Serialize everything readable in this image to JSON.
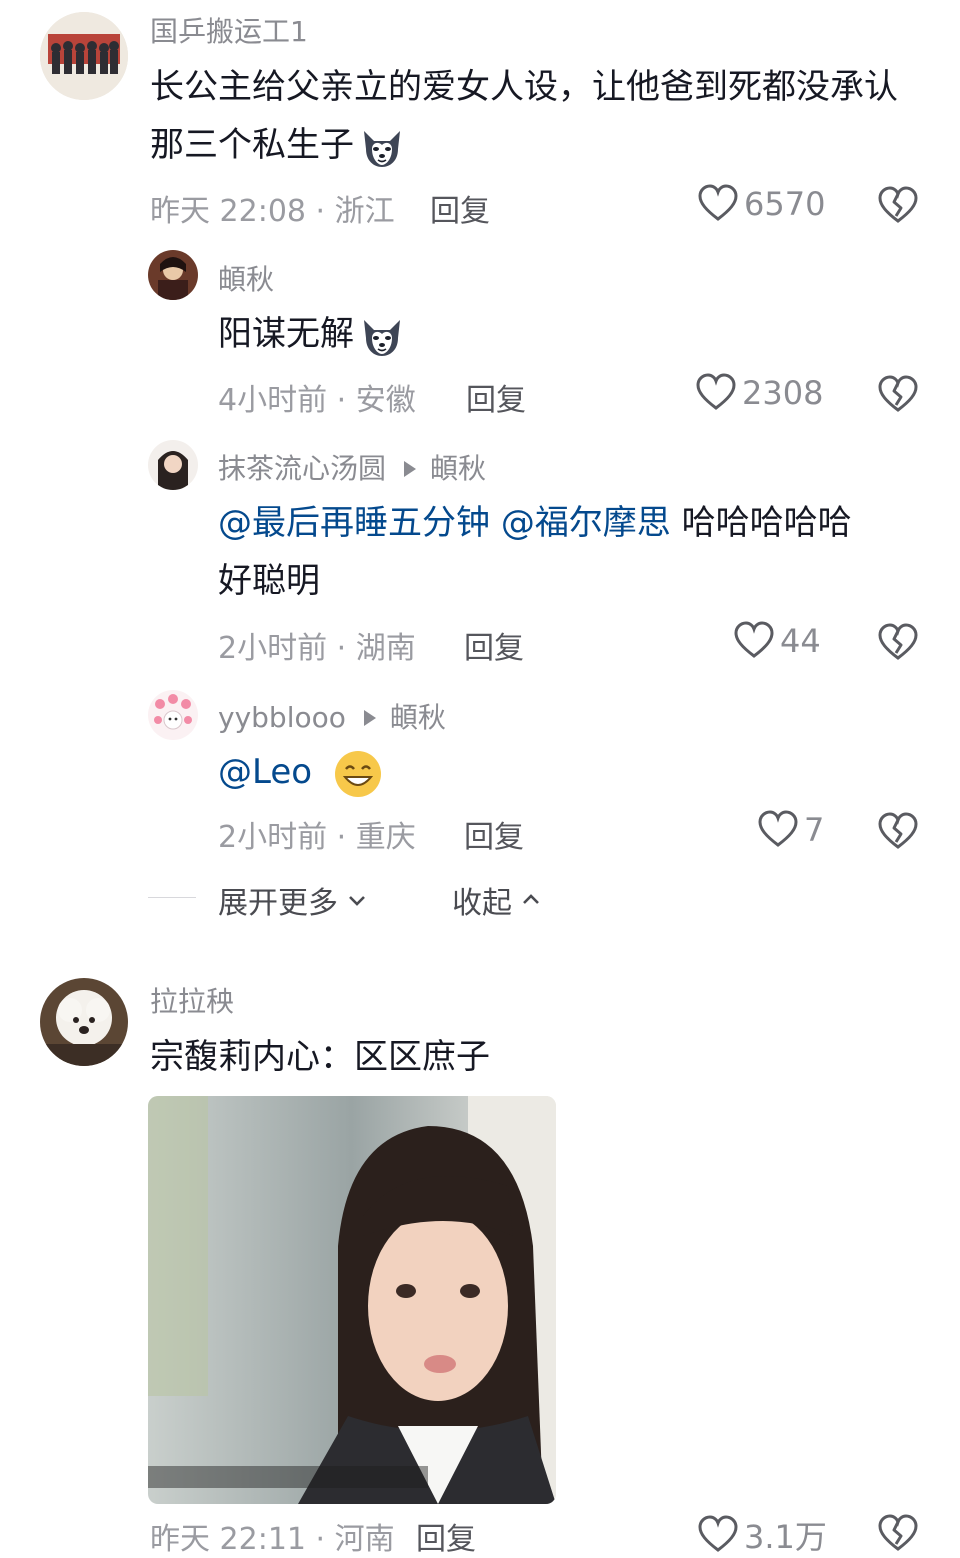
{
  "comments": [
    {
      "username": "国乒搬运工1",
      "text": "长公主给父亲立的爱女人设，让他爸到死都没承认那三个私生子",
      "meta": "昨天 22:08 · 浙江",
      "reply_label": "回复",
      "likes": "6570",
      "replies": [
        {
          "username": "頔秋",
          "text": "阳谋无解",
          "meta": "4小时前 · 安徽",
          "reply_label": "回复",
          "likes": "2308"
        },
        {
          "username": "抹茶流心汤圆",
          "reply_to": "頔秋",
          "mention1": "@最后再睡五分钟",
          "mention2": "@福尔摩思",
          "text_line1": "哈哈哈哈哈",
          "text_line2": "好聪明",
          "meta": "2小时前 · 湖南",
          "reply_label": "回复",
          "likes": "44"
        },
        {
          "username": "yybblooo",
          "reply_to": "頔秋",
          "mention": "@Leo",
          "meta": "2小时前 · 重庆",
          "reply_label": "回复",
          "likes": "7"
        }
      ],
      "expand_more": "展开更多",
      "collapse": "收起"
    },
    {
      "username": "拉拉秧",
      "text": "宗馥莉内心：区区庶子",
      "meta": "昨天 22:11 · 河南",
      "reply_label": "回复",
      "likes": "3.1万"
    }
  ],
  "colors": {
    "mention": "#04498d",
    "meta": "#9a9ba1",
    "text": "#161823"
  }
}
